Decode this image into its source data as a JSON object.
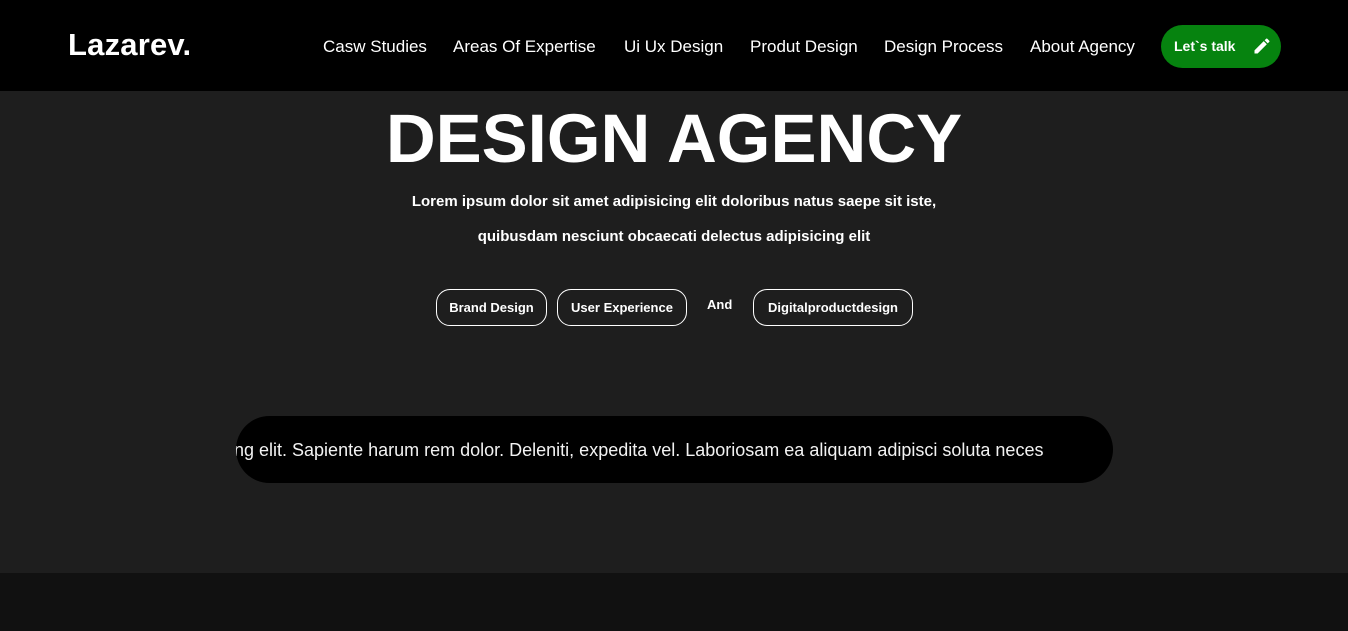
{
  "header": {
    "logo": "Lazarev.",
    "nav": [
      {
        "label": "Casw Studies"
      },
      {
        "label": "Areas Of Expertise"
      },
      {
        "label": "Ui Ux Design"
      },
      {
        "label": "Produt Design"
      },
      {
        "label": "Design Process"
      },
      {
        "label": "About Agency"
      }
    ],
    "cta_label": "Let`s talk",
    "cta_icon": "pencil-icon"
  },
  "hero": {
    "title": "DESIGN AGENCY",
    "subtitle_line1": "Lorem ipsum dolor sit amet adipisicing elit doloribus natus saepe sit iste,",
    "subtitle_line2": "quibusdam nesciunt obcaecati delectus adipisicing elit",
    "tags": [
      {
        "label": "Brand Design"
      },
      {
        "label": "User Experience"
      },
      {
        "label": "Digitalproductdesign"
      }
    ],
    "connector": "And",
    "marquee": "ng elit. Sapiente harum rem dolor. Deleniti, expedita vel. Laboriosam ea aliquam adipisci soluta neces"
  },
  "colors": {
    "header_bg": "#000000",
    "hero_bg": "#1e1e1e",
    "accent_green": "#06830f",
    "marquee_bg": "#000000",
    "footer_bg": "#111111"
  }
}
